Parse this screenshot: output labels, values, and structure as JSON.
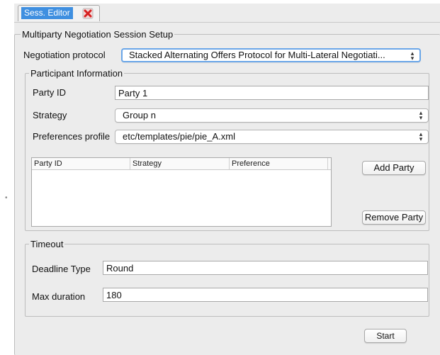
{
  "tab": {
    "title": "Sess. Editor",
    "close_icon": "close-red-x-icon"
  },
  "setup": {
    "legend": "Multiparty Negotiation Session Setup",
    "protocol_label": "Negotiation protocol",
    "protocol_value": "Stacked Alternating Offers Protocol for Multi-Lateral Negotiati..."
  },
  "participants": {
    "legend": "Participant Information",
    "party_id_label": "Party ID",
    "party_id_value": "Party 1",
    "strategy_label": "Strategy",
    "strategy_value": "Group n",
    "preferences_label": "Preferences profile",
    "preferences_value": "etc/templates/pie/pie_A.xml",
    "table_headers": [
      "Party ID",
      "Strategy",
      "Preference"
    ],
    "add_party": "Add Party",
    "remove_party": "Remove Party"
  },
  "timeout": {
    "legend": "Timeout",
    "deadline_type_label": "Deadline Type",
    "deadline_type_value": "Round",
    "max_duration_label": "Max duration",
    "max_duration_value": "180"
  },
  "start_button": "Start",
  "colors": {
    "tab_selected": "#3f8fe0",
    "focus_ring": "#6aa6e8",
    "panel_bg": "#ececec"
  }
}
